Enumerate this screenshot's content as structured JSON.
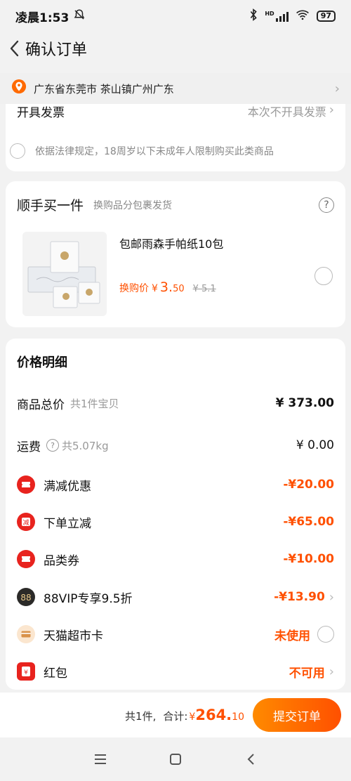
{
  "status": {
    "time": "凌晨1:53",
    "battery": "97",
    "network": "HD"
  },
  "header": {
    "title": "确认订单"
  },
  "address": {
    "text": "广东省东莞市 茶山镇广州广东"
  },
  "invoice": {
    "label": "开具发票",
    "value": "本次不开具发票"
  },
  "law_notice": "依据法律规定，18周岁以下未成年人限制购买此类商品",
  "addon": {
    "title": "顺手买一件",
    "subtitle": "换购品分包裹发货",
    "product_name": "包邮雨森手帕纸10包",
    "price_label": "换购价",
    "currency": "¥",
    "price_int": "3.",
    "price_dec": "50",
    "original_price": "¥ 5.1"
  },
  "price_detail": {
    "title": "价格明细",
    "rows": [
      {
        "label": "商品总价",
        "sub": "共1件宝贝",
        "value": "¥ 373.00"
      },
      {
        "label": "运费",
        "sub": "共5.07kg",
        "value": "¥ 0.00"
      },
      {
        "label": "满减优惠",
        "value": "-¥20.00"
      },
      {
        "label": "下单立减",
        "value": "-¥65.00"
      },
      {
        "label": "品类券",
        "value": "-¥10.00"
      },
      {
        "label": "88VIP专享9.5折",
        "value": "-¥13.90"
      },
      {
        "label": "天猫超市卡",
        "value": "未使用"
      },
      {
        "label": "红包",
        "value": "不可用"
      }
    ]
  },
  "bottom": {
    "count": "共1件,",
    "total_label": "合计:",
    "currency": "¥",
    "total_main": "264.",
    "total_dec": "10",
    "submit": "提交订单"
  },
  "colors": {
    "accent": "#ff5000",
    "coupon_red": "#e8231e",
    "vip_dark": "#2b2a28"
  }
}
